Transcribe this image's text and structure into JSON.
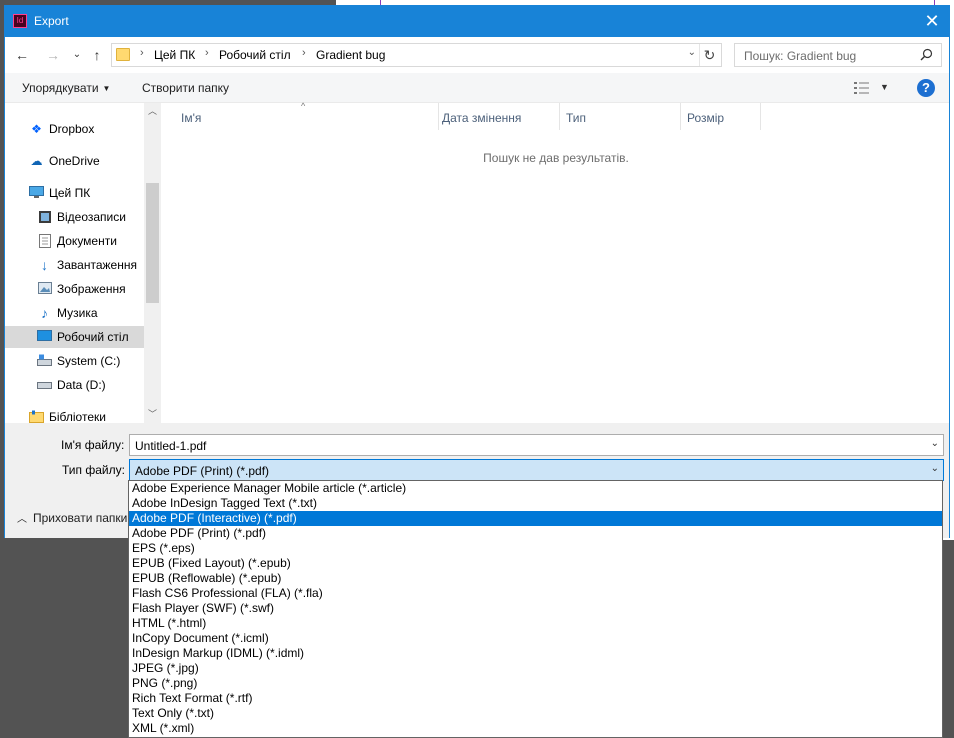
{
  "window": {
    "title": "Export",
    "app_icon_text": "Id",
    "close_glyph": "✕"
  },
  "nav": {
    "back": "←",
    "forward": "→",
    "recent": "⌄",
    "up": "↑",
    "breadcrumb": [
      "Цей ПК",
      "Робочий стіл",
      "Gradient bug"
    ],
    "separator": "›",
    "refresh": "↻",
    "search_placeholder": "Пошук: Gradient bug"
  },
  "toolbar": {
    "organize": "Упорядкувати",
    "new_folder": "Створити папку",
    "help": "?"
  },
  "sidebar": {
    "items": [
      {
        "label": "Dropbox",
        "icon": "dropbox-icon"
      },
      {
        "label": "OneDrive",
        "icon": "onedrive-icon"
      },
      {
        "label": "Цей ПК",
        "icon": "computer-icon"
      },
      {
        "label": "Відеозаписи",
        "icon": "videos-icon"
      },
      {
        "label": "Документи",
        "icon": "documents-icon"
      },
      {
        "label": "Завантаження",
        "icon": "downloads-icon"
      },
      {
        "label": "Зображення",
        "icon": "pictures-icon"
      },
      {
        "label": "Музика",
        "icon": "music-icon"
      },
      {
        "label": "Робочий стіл",
        "icon": "desktop-icon"
      },
      {
        "label": "System (C:)",
        "icon": "drive-c-icon"
      },
      {
        "label": "Data (D:)",
        "icon": "drive-d-icon"
      },
      {
        "label": "Бібліотеки",
        "icon": "libraries-icon"
      }
    ],
    "selected": "Робочий стіл"
  },
  "filelist": {
    "columns": [
      "Ім'я",
      "Дата змінення",
      "Тип",
      "Розмір"
    ],
    "empty_message": "Пошук не дав результатів."
  },
  "form": {
    "filename_label": "Ім'я файлу:",
    "filename_value": "Untitled-1.pdf",
    "filetype_label": "Тип файлу:",
    "filetype_value": "Adobe PDF (Print) (*.pdf)",
    "hide_folders": "Приховати папки"
  },
  "filetype_options": [
    "Adobe Experience Manager Mobile article (*.article)",
    "Adobe InDesign Tagged Text (*.txt)",
    "Adobe PDF (Interactive) (*.pdf)",
    "Adobe PDF (Print) (*.pdf)",
    "EPS (*.eps)",
    "EPUB (Fixed Layout) (*.epub)",
    "EPUB (Reflowable) (*.epub)",
    "Flash CS6 Professional (FLA) (*.fla)",
    "Flash Player (SWF) (*.swf)",
    "HTML (*.html)",
    "InCopy Document (*.icml)",
    "InDesign Markup (IDML) (*.idml)",
    "JPEG (*.jpg)",
    "PNG (*.png)",
    "Rich Text Format (*.rtf)",
    "Text Only (*.txt)",
    "XML (*.xml)"
  ],
  "highlighted_option": "Adobe PDF (Interactive) (*.pdf)",
  "colors": {
    "titlebar": "#1883d7",
    "highlight": "#0078d7",
    "selected_field": "#cce4f7"
  }
}
